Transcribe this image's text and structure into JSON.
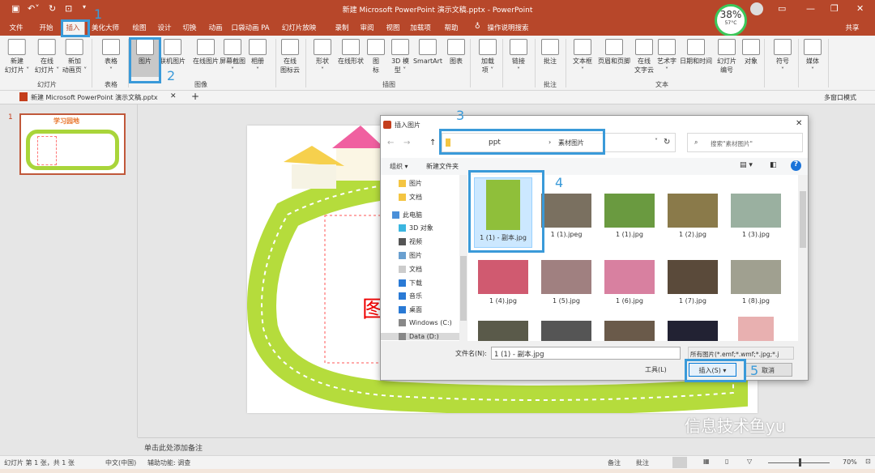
{
  "window": {
    "title": "新建 Microsoft PowerPoint 演示文稿.pptx  -  PowerPoint",
    "share": "共享",
    "search_hint": "操作说明搜索"
  },
  "system_gauge": {
    "cpu_percent": "38%",
    "temperature": "57°C"
  },
  "menu_tabs": [
    "文件",
    "开始",
    "插入",
    "美化大师",
    "绘图",
    "设计",
    "切换",
    "动画",
    "口袋动画 PA",
    "幻灯片放映",
    "录制",
    "审阅",
    "视图",
    "加载项",
    "帮助"
  ],
  "active_tab": "插入",
  "ribbon": {
    "items": [
      "新建\n幻灯片 ˅",
      "在线\n幻灯片 ˅",
      "新加\n动画页 ˅",
      "表格\n˅",
      "图片",
      "联机图片",
      "在线图片",
      "屏幕截图\n˅",
      "相册\n˅",
      "在线\n图标云",
      "形状\n˅",
      "在线形状",
      "图\n标",
      "3D 模\n型 ˅",
      "SmartArt",
      "图表",
      "加载\n项 ˅",
      "链接\n˅",
      "批注",
      "文本框\n˅",
      "页眉和页脚",
      "在线\n文字云",
      "艺术字\n˅",
      "日期和时间",
      "幻灯片\n编号",
      "对象",
      "符号\n˅",
      "媒体\n˅"
    ],
    "groups": [
      "幻灯片",
      "表格",
      "图像",
      "插图",
      "批注",
      "文本"
    ]
  },
  "doc_tab": {
    "label": "新建 Microsoft PowerPoint 演示文稿.pptx",
    "multiwindow": "多窗口模式"
  },
  "thumbnails": {
    "slide_number": "1"
  },
  "slide": {
    "placeholder_text": "图"
  },
  "notes_placeholder": "单击此处添加备注",
  "status": {
    "slide_info": "幻灯片 第 1 张，共 1 张",
    "language": "中文(中国)",
    "accessibility": "辅助功能: 调查",
    "notes": "备注",
    "comments": "批注",
    "zoom": "70%"
  },
  "dialog": {
    "title": "插入图片",
    "path": [
      "ppt",
      "素材图片"
    ],
    "search_placeholder": "搜索\"素材图片\"",
    "organize": "组织 ▾",
    "new_folder": "新建文件夹",
    "nav": [
      "图片",
      "文档",
      "此电脑",
      "3D 对象",
      "视频",
      "图片",
      "文档",
      "下载",
      "音乐",
      "桌面",
      "Windows (C:)",
      "Data (D:)"
    ],
    "files": [
      "1 (1) - 副本.jpg",
      "1 (1).jpeg",
      "1 (1).jpg",
      "1 (2).jpg",
      "1 (3).jpg",
      "1 (4).jpg",
      "1 (5).jpg",
      "1 (6).jpg",
      "1 (7).jpg",
      "1 (8).jpg",
      "",
      "",
      "",
      "",
      ""
    ],
    "filename_label": "文件名(N):",
    "filename_value": "1 (1) - 副本.jpg",
    "filter": "所有图片(*.emf;*.wmf;*.jpg;*.j",
    "tools": "工具(L)",
    "insert": "插入(S)",
    "cancel": "取消"
  },
  "annotations": [
    "1",
    "2",
    "3",
    "4",
    "5"
  ],
  "watermark": "信息技术鱼yu",
  "colors": {
    "accent": "#b7472a",
    "callout": "#3a9ad9",
    "selection": "#cce8ff"
  }
}
